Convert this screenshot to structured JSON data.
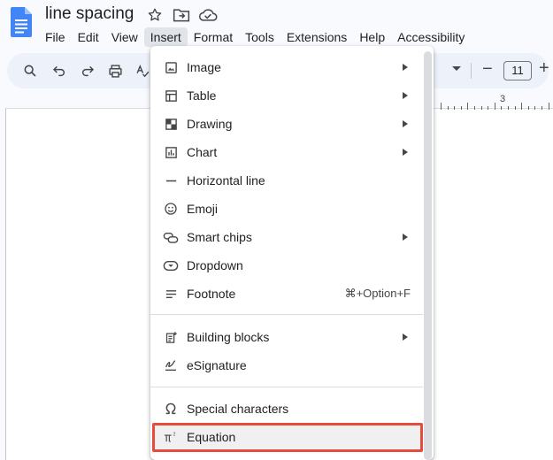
{
  "document": {
    "title": "line spacing"
  },
  "menubar": {
    "items": [
      "File",
      "Edit",
      "View",
      "Insert",
      "Format",
      "Tools",
      "Extensions",
      "Help",
      "Accessibility"
    ],
    "active_index": 3
  },
  "toolbar": {
    "font_size": "11",
    "minus": "−",
    "plus": "+"
  },
  "ruler": {
    "marker": "3"
  },
  "insert_menu": {
    "items": [
      {
        "label": "Image",
        "icon": "image-icon",
        "submenu": true
      },
      {
        "label": "Table",
        "icon": "table-icon",
        "submenu": true
      },
      {
        "label": "Drawing",
        "icon": "drawing-icon",
        "submenu": true
      },
      {
        "label": "Chart",
        "icon": "chart-icon",
        "submenu": true
      },
      {
        "label": "Horizontal line",
        "icon": "horizontal-line-icon",
        "submenu": false
      },
      {
        "label": "Emoji",
        "icon": "emoji-icon",
        "submenu": false
      },
      {
        "label": "Smart chips",
        "icon": "smart-chips-icon",
        "submenu": true
      },
      {
        "label": "Dropdown",
        "icon": "dropdown-icon",
        "submenu": false
      },
      {
        "label": "Footnote",
        "icon": "footnote-icon",
        "submenu": false,
        "shortcut": "⌘+Option+F"
      },
      {
        "label": "Building blocks",
        "icon": "building-blocks-icon",
        "submenu": true
      },
      {
        "label": "eSignature",
        "icon": "esignature-icon",
        "submenu": false
      },
      {
        "label": "Special characters",
        "icon": "omega-icon",
        "submenu": false
      },
      {
        "label": "Equation",
        "icon": "pi-icon",
        "submenu": false,
        "highlighted": true
      }
    ]
  },
  "colors": {
    "highlight_border": "#e64b3c",
    "doc_icon_blue": "#4285f4"
  }
}
